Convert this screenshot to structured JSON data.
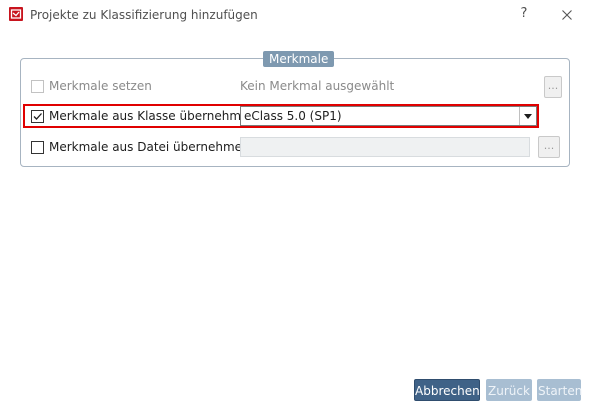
{
  "window": {
    "title": "Projekte zu Klassifizierung hinzufügen",
    "help_label": "?",
    "close_icon": "close-icon",
    "app_icon": "app-logo-icon",
    "brand_color": "#c8141e"
  },
  "group": {
    "caption": "Merkmale"
  },
  "rows": [
    {
      "label": "Merkmale setzen",
      "checked": false,
      "enabled": false,
      "value": "Kein Merkmal ausgewählt",
      "button_label": "..."
    },
    {
      "label": "Merkmale aus Klasse übernehmen",
      "checked": true,
      "enabled": true,
      "selected_option": "eClass 5.0 (SP1)",
      "highlighted": true,
      "highlight_color": "#e00000"
    },
    {
      "label": "Merkmale aus Datei übernehmen",
      "checked": false,
      "enabled": true,
      "value": "",
      "button_label": "..."
    }
  ],
  "footer": {
    "buttons": [
      {
        "label": "Abbrechen",
        "enabled": true
      },
      {
        "label": "Zurück",
        "enabled": false
      },
      {
        "label": "Starten",
        "enabled": false
      }
    ],
    "accent": "#3f6287"
  }
}
